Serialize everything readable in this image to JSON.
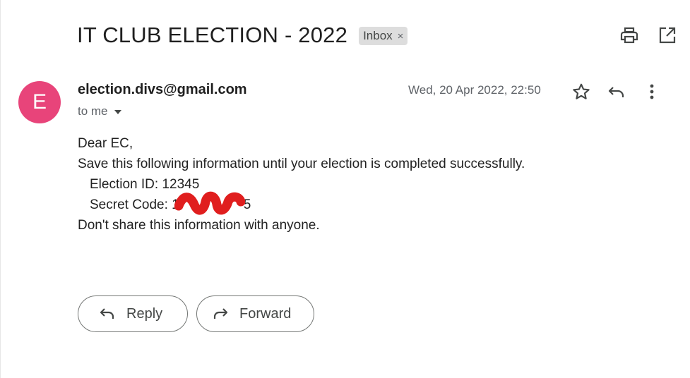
{
  "email": {
    "subject": "IT CLUB ELECTION - 2022",
    "label": "Inbox",
    "label_remove": "×",
    "sender_initial": "E",
    "sender": "election.divs@gmail.com",
    "recipient": "to me",
    "date": "Wed, 20 Apr 2022, 22:50",
    "body": {
      "greeting": "Dear EC,",
      "line1": "Save this following  information until your election is completed successfully.",
      "election_id": "Election ID: 12345",
      "secret_code": "Secret Code: 1",
      "secret_code_tail": "5",
      "line_last": "Don't share this information with anyone."
    }
  },
  "actions": {
    "reply": "Reply",
    "forward": "Forward"
  },
  "colors": {
    "avatar": "#e8447a",
    "redaction": "#e01e1e"
  },
  "icons": {
    "print": "print-icon",
    "open_new": "open-in-new-window-icon",
    "star": "star-icon",
    "reply": "reply-icon",
    "more": "more-vert-icon",
    "forward": "forward-icon"
  }
}
